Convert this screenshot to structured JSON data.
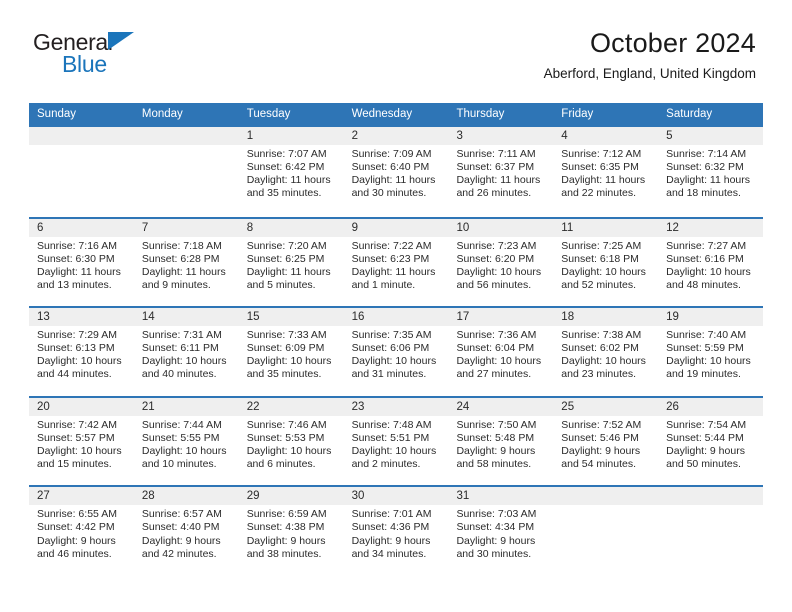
{
  "brand": {
    "name_line1": "General",
    "name_line2": "Blue",
    "accent_color": "#1b75bb"
  },
  "header": {
    "title": "October 2024",
    "subtitle": "Aberford, England, United Kingdom",
    "header_bg_color": "#2e75b6",
    "day_number_bg_color": "#efefef"
  },
  "weekday_headers": [
    "Sunday",
    "Monday",
    "Tuesday",
    "Wednesday",
    "Thursday",
    "Friday",
    "Saturday"
  ],
  "weeks": [
    [
      {
        "day": "",
        "lines": []
      },
      {
        "day": "",
        "lines": []
      },
      {
        "day": "1",
        "lines": [
          "Sunrise: 7:07 AM",
          "Sunset: 6:42 PM",
          "Daylight: 11 hours",
          "and 35 minutes."
        ]
      },
      {
        "day": "2",
        "lines": [
          "Sunrise: 7:09 AM",
          "Sunset: 6:40 PM",
          "Daylight: 11 hours",
          "and 30 minutes."
        ]
      },
      {
        "day": "3",
        "lines": [
          "Sunrise: 7:11 AM",
          "Sunset: 6:37 PM",
          "Daylight: 11 hours",
          "and 26 minutes."
        ]
      },
      {
        "day": "4",
        "lines": [
          "Sunrise: 7:12 AM",
          "Sunset: 6:35 PM",
          "Daylight: 11 hours",
          "and 22 minutes."
        ]
      },
      {
        "day": "5",
        "lines": [
          "Sunrise: 7:14 AM",
          "Sunset: 6:32 PM",
          "Daylight: 11 hours",
          "and 18 minutes."
        ]
      }
    ],
    [
      {
        "day": "6",
        "lines": [
          "Sunrise: 7:16 AM",
          "Sunset: 6:30 PM",
          "Daylight: 11 hours",
          "and 13 minutes."
        ]
      },
      {
        "day": "7",
        "lines": [
          "Sunrise: 7:18 AM",
          "Sunset: 6:28 PM",
          "Daylight: 11 hours",
          "and 9 minutes."
        ]
      },
      {
        "day": "8",
        "lines": [
          "Sunrise: 7:20 AM",
          "Sunset: 6:25 PM",
          "Daylight: 11 hours",
          "and 5 minutes."
        ]
      },
      {
        "day": "9",
        "lines": [
          "Sunrise: 7:22 AM",
          "Sunset: 6:23 PM",
          "Daylight: 11 hours",
          "and 1 minute."
        ]
      },
      {
        "day": "10",
        "lines": [
          "Sunrise: 7:23 AM",
          "Sunset: 6:20 PM",
          "Daylight: 10 hours",
          "and 56 minutes."
        ]
      },
      {
        "day": "11",
        "lines": [
          "Sunrise: 7:25 AM",
          "Sunset: 6:18 PM",
          "Daylight: 10 hours",
          "and 52 minutes."
        ]
      },
      {
        "day": "12",
        "lines": [
          "Sunrise: 7:27 AM",
          "Sunset: 6:16 PM",
          "Daylight: 10 hours",
          "and 48 minutes."
        ]
      }
    ],
    [
      {
        "day": "13",
        "lines": [
          "Sunrise: 7:29 AM",
          "Sunset: 6:13 PM",
          "Daylight: 10 hours",
          "and 44 minutes."
        ]
      },
      {
        "day": "14",
        "lines": [
          "Sunrise: 7:31 AM",
          "Sunset: 6:11 PM",
          "Daylight: 10 hours",
          "and 40 minutes."
        ]
      },
      {
        "day": "15",
        "lines": [
          "Sunrise: 7:33 AM",
          "Sunset: 6:09 PM",
          "Daylight: 10 hours",
          "and 35 minutes."
        ]
      },
      {
        "day": "16",
        "lines": [
          "Sunrise: 7:35 AM",
          "Sunset: 6:06 PM",
          "Daylight: 10 hours",
          "and 31 minutes."
        ]
      },
      {
        "day": "17",
        "lines": [
          "Sunrise: 7:36 AM",
          "Sunset: 6:04 PM",
          "Daylight: 10 hours",
          "and 27 minutes."
        ]
      },
      {
        "day": "18",
        "lines": [
          "Sunrise: 7:38 AM",
          "Sunset: 6:02 PM",
          "Daylight: 10 hours",
          "and 23 minutes."
        ]
      },
      {
        "day": "19",
        "lines": [
          "Sunrise: 7:40 AM",
          "Sunset: 5:59 PM",
          "Daylight: 10 hours",
          "and 19 minutes."
        ]
      }
    ],
    [
      {
        "day": "20",
        "lines": [
          "Sunrise: 7:42 AM",
          "Sunset: 5:57 PM",
          "Daylight: 10 hours",
          "and 15 minutes."
        ]
      },
      {
        "day": "21",
        "lines": [
          "Sunrise: 7:44 AM",
          "Sunset: 5:55 PM",
          "Daylight: 10 hours",
          "and 10 minutes."
        ]
      },
      {
        "day": "22",
        "lines": [
          "Sunrise: 7:46 AM",
          "Sunset: 5:53 PM",
          "Daylight: 10 hours",
          "and 6 minutes."
        ]
      },
      {
        "day": "23",
        "lines": [
          "Sunrise: 7:48 AM",
          "Sunset: 5:51 PM",
          "Daylight: 10 hours",
          "and 2 minutes."
        ]
      },
      {
        "day": "24",
        "lines": [
          "Sunrise: 7:50 AM",
          "Sunset: 5:48 PM",
          "Daylight: 9 hours",
          "and 58 minutes."
        ]
      },
      {
        "day": "25",
        "lines": [
          "Sunrise: 7:52 AM",
          "Sunset: 5:46 PM",
          "Daylight: 9 hours",
          "and 54 minutes."
        ]
      },
      {
        "day": "26",
        "lines": [
          "Sunrise: 7:54 AM",
          "Sunset: 5:44 PM",
          "Daylight: 9 hours",
          "and 50 minutes."
        ]
      }
    ],
    [
      {
        "day": "27",
        "lines": [
          "Sunrise: 6:55 AM",
          "Sunset: 4:42 PM",
          "Daylight: 9 hours",
          "and 46 minutes."
        ]
      },
      {
        "day": "28",
        "lines": [
          "Sunrise: 6:57 AM",
          "Sunset: 4:40 PM",
          "Daylight: 9 hours",
          "and 42 minutes."
        ]
      },
      {
        "day": "29",
        "lines": [
          "Sunrise: 6:59 AM",
          "Sunset: 4:38 PM",
          "Daylight: 9 hours",
          "and 38 minutes."
        ]
      },
      {
        "day": "30",
        "lines": [
          "Sunrise: 7:01 AM",
          "Sunset: 4:36 PM",
          "Daylight: 9 hours",
          "and 34 minutes."
        ]
      },
      {
        "day": "31",
        "lines": [
          "Sunrise: 7:03 AM",
          "Sunset: 4:34 PM",
          "Daylight: 9 hours",
          "and 30 minutes."
        ]
      },
      {
        "day": "",
        "lines": []
      },
      {
        "day": "",
        "lines": []
      }
    ]
  ]
}
